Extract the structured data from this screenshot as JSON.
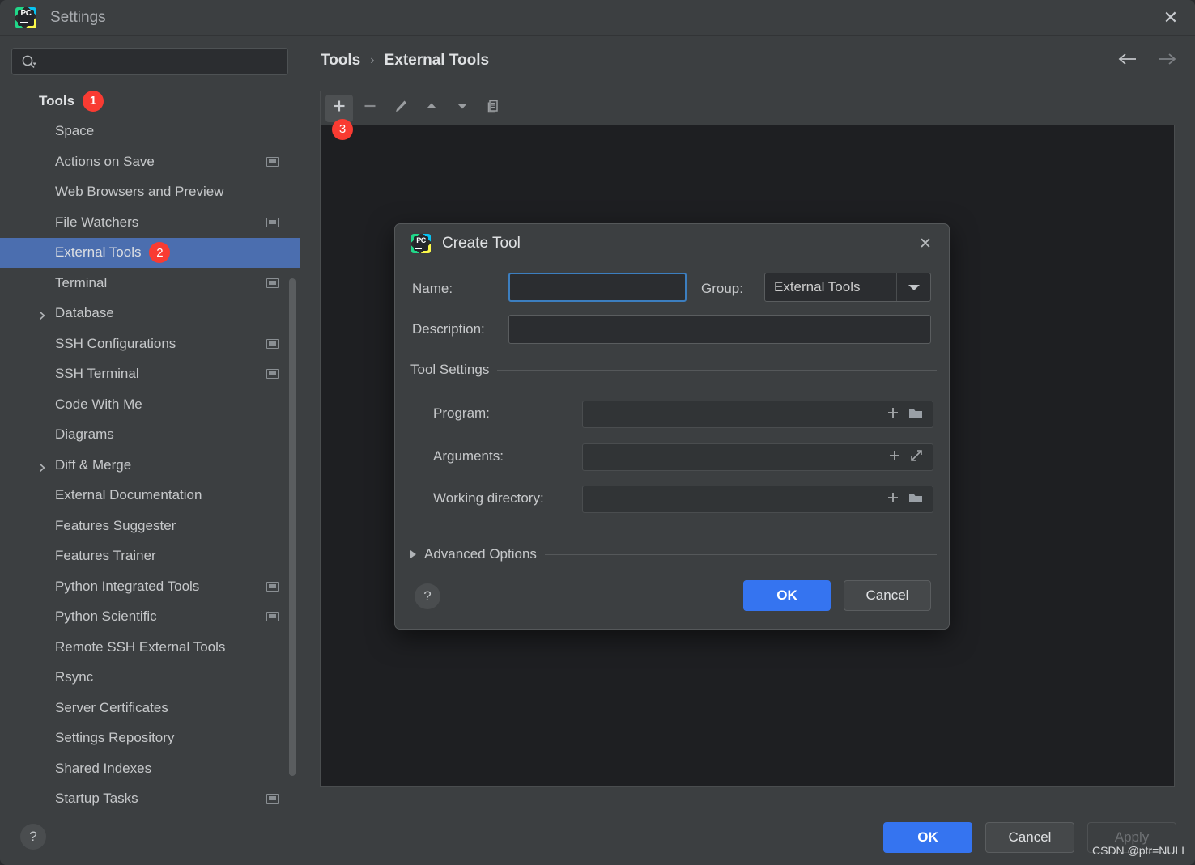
{
  "window": {
    "title": "Settings",
    "logo_text": "PC",
    "close_icon": "close-icon"
  },
  "search": {
    "value": "",
    "placeholder": "",
    "icon": "search-icon"
  },
  "sidebar": {
    "root": {
      "label": "Tools",
      "badge": "1"
    },
    "items": [
      {
        "label": "Space",
        "scoped": false,
        "expandable": false,
        "selected": false
      },
      {
        "label": "Actions on Save",
        "scoped": true,
        "expandable": false,
        "selected": false
      },
      {
        "label": "Web Browsers and Preview",
        "scoped": false,
        "expandable": false,
        "selected": false
      },
      {
        "label": "File Watchers",
        "scoped": true,
        "expandable": false,
        "selected": false
      },
      {
        "label": "External Tools",
        "scoped": false,
        "expandable": false,
        "selected": true,
        "badge": "2"
      },
      {
        "label": "Terminal",
        "scoped": true,
        "expandable": false,
        "selected": false
      },
      {
        "label": "Database",
        "scoped": false,
        "expandable": true,
        "selected": false
      },
      {
        "label": "SSH Configurations",
        "scoped": true,
        "expandable": false,
        "selected": false
      },
      {
        "label": "SSH Terminal",
        "scoped": true,
        "expandable": false,
        "selected": false
      },
      {
        "label": "Code With Me",
        "scoped": false,
        "expandable": false,
        "selected": false
      },
      {
        "label": "Diagrams",
        "scoped": false,
        "expandable": false,
        "selected": false
      },
      {
        "label": "Diff & Merge",
        "scoped": false,
        "expandable": true,
        "selected": false
      },
      {
        "label": "External Documentation",
        "scoped": false,
        "expandable": false,
        "selected": false
      },
      {
        "label": "Features Suggester",
        "scoped": false,
        "expandable": false,
        "selected": false
      },
      {
        "label": "Features Trainer",
        "scoped": false,
        "expandable": false,
        "selected": false
      },
      {
        "label": "Python Integrated Tools",
        "scoped": true,
        "expandable": false,
        "selected": false
      },
      {
        "label": "Python Scientific",
        "scoped": true,
        "expandable": false,
        "selected": false
      },
      {
        "label": "Remote SSH External Tools",
        "scoped": false,
        "expandable": false,
        "selected": false
      },
      {
        "label": "Rsync",
        "scoped": false,
        "expandable": false,
        "selected": false
      },
      {
        "label": "Server Certificates",
        "scoped": false,
        "expandable": false,
        "selected": false
      },
      {
        "label": "Settings Repository",
        "scoped": false,
        "expandable": false,
        "selected": false
      },
      {
        "label": "Shared Indexes",
        "scoped": false,
        "expandable": false,
        "selected": false
      },
      {
        "label": "Startup Tasks",
        "scoped": true,
        "expandable": false,
        "selected": false
      }
    ]
  },
  "content": {
    "breadcrumb": {
      "parent": "Tools",
      "separator": "›",
      "current": "External Tools"
    },
    "nav": {
      "back_icon": "arrow-left-icon",
      "forward_icon": "arrow-right-icon"
    },
    "toolbar": {
      "badge": "3",
      "buttons": [
        {
          "name": "add-tool-button",
          "icon": "plus-icon",
          "active": true
        },
        {
          "name": "remove-tool-button",
          "icon": "minus-icon",
          "active": false
        },
        {
          "name": "edit-tool-button",
          "icon": "pencil-icon",
          "active": false
        },
        {
          "name": "move-up-button",
          "icon": "arrow-up-icon",
          "active": false
        },
        {
          "name": "move-down-button",
          "icon": "arrow-down-icon",
          "active": false
        },
        {
          "name": "copy-tool-button",
          "icon": "copy-icon",
          "active": false
        }
      ]
    }
  },
  "dialog": {
    "title": "Create Tool",
    "logo_text": "PC",
    "close_icon": "close-icon",
    "name": {
      "label": "Name:",
      "value": "",
      "placeholder": ""
    },
    "group": {
      "label": "Group:",
      "value": "External Tools",
      "options": [
        "External Tools"
      ]
    },
    "description": {
      "label": "Description:",
      "value": "",
      "placeholder": ""
    },
    "tool_settings": {
      "title": "Tool Settings",
      "fields": [
        {
          "label": "Program:",
          "value": "",
          "icons": [
            "plus-icon",
            "folder-icon"
          ]
        },
        {
          "label": "Arguments:",
          "value": "",
          "icons": [
            "plus-icon",
            "expand-icon"
          ]
        },
        {
          "label": "Working directory:",
          "value": "",
          "icons": [
            "plus-icon",
            "folder-icon"
          ]
        }
      ]
    },
    "advanced_options": {
      "label": "Advanced Options",
      "expanded": false
    },
    "help_icon": "question-icon",
    "ok_label": "OK",
    "cancel_label": "Cancel"
  },
  "bottom": {
    "help_icon": "question-icon",
    "ok_label": "OK",
    "cancel_label": "Cancel",
    "apply_label": "Apply",
    "apply_disabled": true
  },
  "watermark": "CSDN @ptr=NULL",
  "colors": {
    "selection_blue": "#4b6eaf",
    "primary_blue": "#3574f0",
    "badge_red": "#f93b32",
    "panel_bg": "#1e1f22",
    "window_bg": "#3c3f41",
    "focus_border": "#3c7ebf"
  }
}
